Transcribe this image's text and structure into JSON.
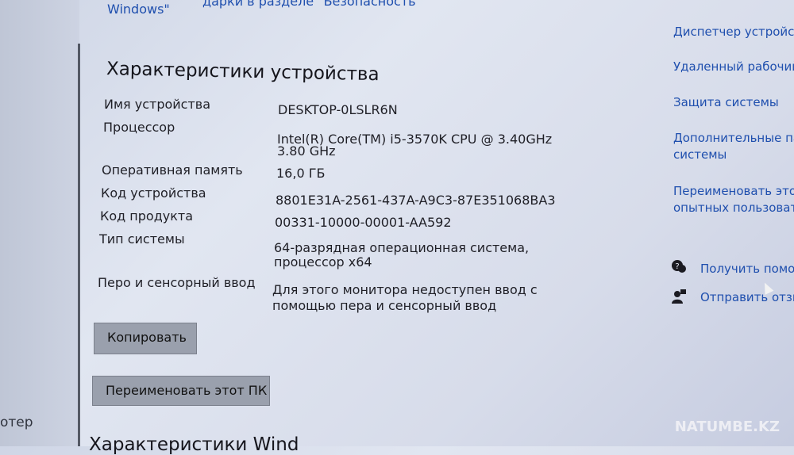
{
  "top": {
    "windows_text": "Windows\"",
    "security_text": "дарки в разделе \"Безопасность"
  },
  "main": {
    "title": "Характеристики устройства",
    "specs": [
      {
        "label": "Имя устройства",
        "value": "DESKTOP-0LSLR6N"
      },
      {
        "label": "Процессор",
        "value1": "Intel(R) Core(TM) i5-3570K CPU @ 3.40GHz",
        "value2": "3.80 GHz"
      },
      {
        "label": "Оперативная память",
        "value": "16,0 ГБ"
      },
      {
        "label": "Код устройства",
        "value": "8801E31A-2561-437A-A9C3-87E351068BA3"
      },
      {
        "label": "Код продукта",
        "value": "00331-10000-00001-AA592"
      },
      {
        "label": "Тип системы",
        "value1": "64-разрядная операционная система,",
        "value2": "процессор x64"
      },
      {
        "label": "Перо и сенсорный ввод",
        "value1": "Для этого монитора недоступен ввод с",
        "value2": "помощью пера и сенсорный ввод"
      }
    ],
    "copy_button": "Копировать",
    "rename_button": "Переименовать этот ПК",
    "bottom_title": "Характеристики Wind"
  },
  "right": {
    "device_manager": "Диспетчер устройс",
    "remote_desktop": "Удаленный рабочий",
    "system_protection": "Защита системы",
    "advanced1": "Дополнительные пар",
    "advanced2": "системы",
    "rename1": "Переименовать этот",
    "rename2": "опытных пользовате",
    "get_help": "Получить помощ",
    "feedback": "Отправить отзы"
  },
  "left": {
    "partial": "отер"
  },
  "watermark": "NATUMBE.KZ"
}
